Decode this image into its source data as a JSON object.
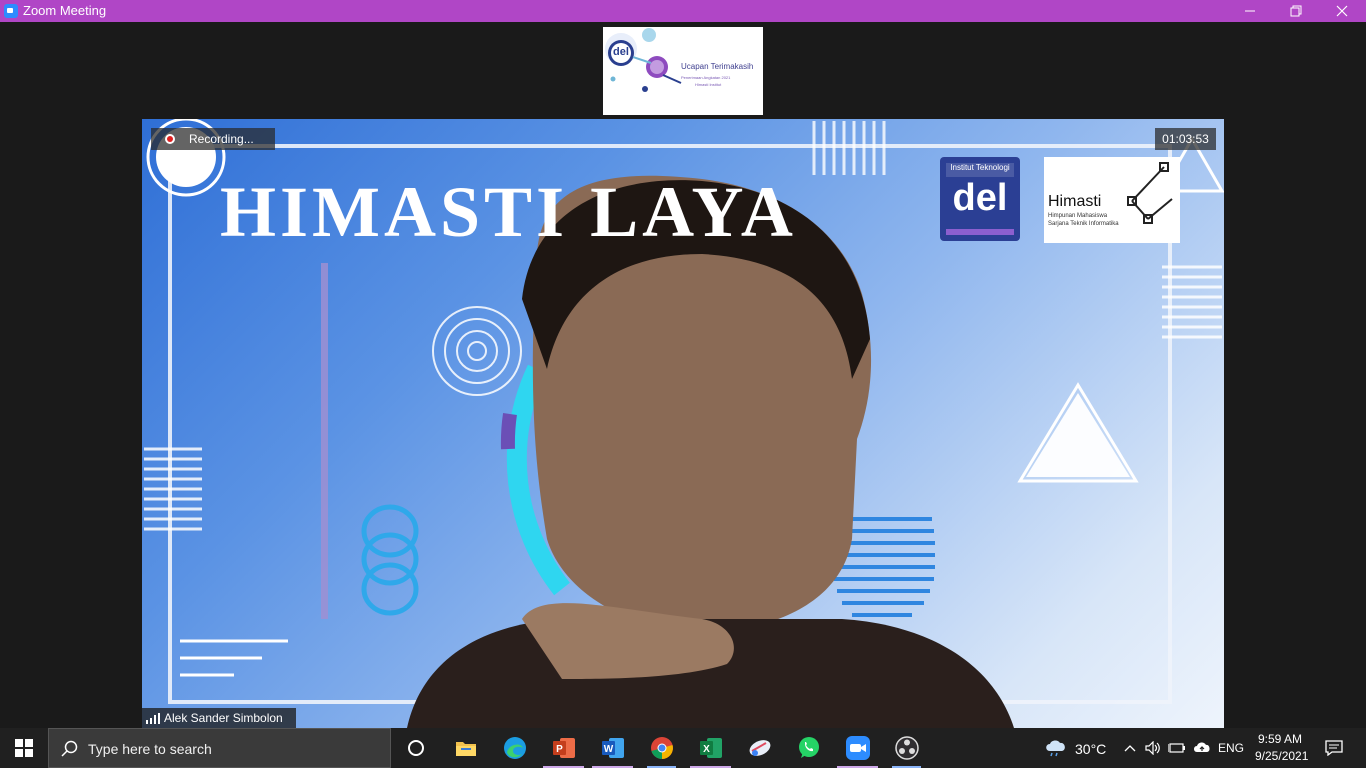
{
  "window": {
    "title": "Zoom Meeting"
  },
  "thumbnail": {
    "slide_title": "Ucapan Terimakasih",
    "slide_subtitle": "Penerimaan Angkatan 2021",
    "slide_subtitle2": "Himasti Institut",
    "logo_text": "del"
  },
  "meeting": {
    "recording_label": "Recording...",
    "elapsed_time": "01:03:53",
    "participant_name": "Alek Sander Simbolon"
  },
  "background_slide": {
    "headline": "HIMASTI LAYA",
    "del_logo_top": "Institut Teknologi",
    "del_logo_text": "del",
    "himasti_logo_title": "Himasti",
    "himasti_logo_sub1": "Himpunan Mahasiswa",
    "himasti_logo_sub2": "Sarjana Teknik Informatika"
  },
  "taskbar": {
    "search_placeholder": "Type here to search",
    "apps": [
      {
        "name": "cortana",
        "icon": "cortana-circle-icon"
      },
      {
        "name": "file-explorer",
        "icon": "folder-icon"
      },
      {
        "name": "edge",
        "icon": "edge-icon"
      },
      {
        "name": "powerpoint",
        "icon": "powerpoint-icon"
      },
      {
        "name": "word",
        "icon": "word-icon"
      },
      {
        "name": "chrome",
        "icon": "chrome-icon"
      },
      {
        "name": "excel",
        "icon": "excel-icon"
      },
      {
        "name": "snipping",
        "icon": "snip-icon"
      },
      {
        "name": "whatsapp",
        "icon": "whatsapp-icon"
      },
      {
        "name": "zoom",
        "icon": "zoom-icon"
      },
      {
        "name": "obs",
        "icon": "obs-icon"
      }
    ],
    "weather": "30°C",
    "language": "ENG",
    "time": "9:59 AM",
    "date": "9/25/2021"
  },
  "colors": {
    "titlebar": "#b046c6",
    "taskbar": "#202020",
    "zoom_blue": "#2d8cff",
    "recording_red": "#e02020"
  }
}
